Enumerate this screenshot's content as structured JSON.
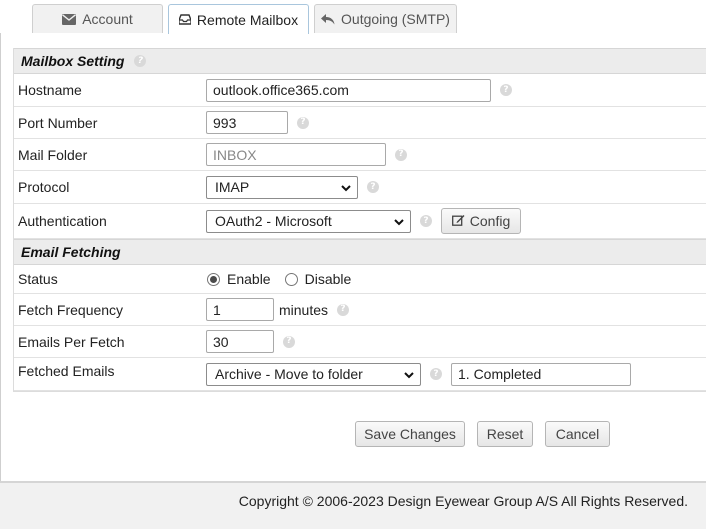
{
  "tabs": {
    "account": "Account",
    "remote_mailbox": "Remote Mailbox",
    "outgoing": "Outgoing (SMTP)"
  },
  "mailbox_setting": {
    "title": "Mailbox Setting",
    "hostname_label": "Hostname",
    "hostname_value": "outlook.office365.com",
    "port_label": "Port Number",
    "port_value": "993",
    "folder_label": "Mail Folder",
    "folder_placeholder": "INBOX",
    "protocol_label": "Protocol",
    "protocol_value": "IMAP",
    "auth_label": "Authentication",
    "auth_value": "OAuth2 - Microsoft",
    "config_button": "Config"
  },
  "email_fetching": {
    "title": "Email Fetching",
    "status_label": "Status",
    "enable_label": "Enable",
    "disable_label": "Disable",
    "status_selected": "Enable",
    "frequency_label": "Fetch Frequency",
    "frequency_value": "1",
    "frequency_unit": "minutes",
    "per_fetch_label": "Emails Per Fetch",
    "per_fetch_value": "30",
    "fetched_label": "Fetched Emails",
    "fetched_action": "Archive - Move to folder",
    "fetched_folder": "1. Completed"
  },
  "actions": {
    "save": "Save Changes",
    "reset": "Reset",
    "cancel": "Cancel"
  },
  "footer": {
    "copyright": "Copyright © 2006-2023 Design Eyewear Group A/S All Rights Reserved."
  },
  "icons": {
    "account": "envelope-icon",
    "remote_mailbox": "inbox-tray-icon",
    "outgoing": "reply-arrow-icon",
    "config": "edit-pencil-icon",
    "help": "question-circle-icon"
  }
}
